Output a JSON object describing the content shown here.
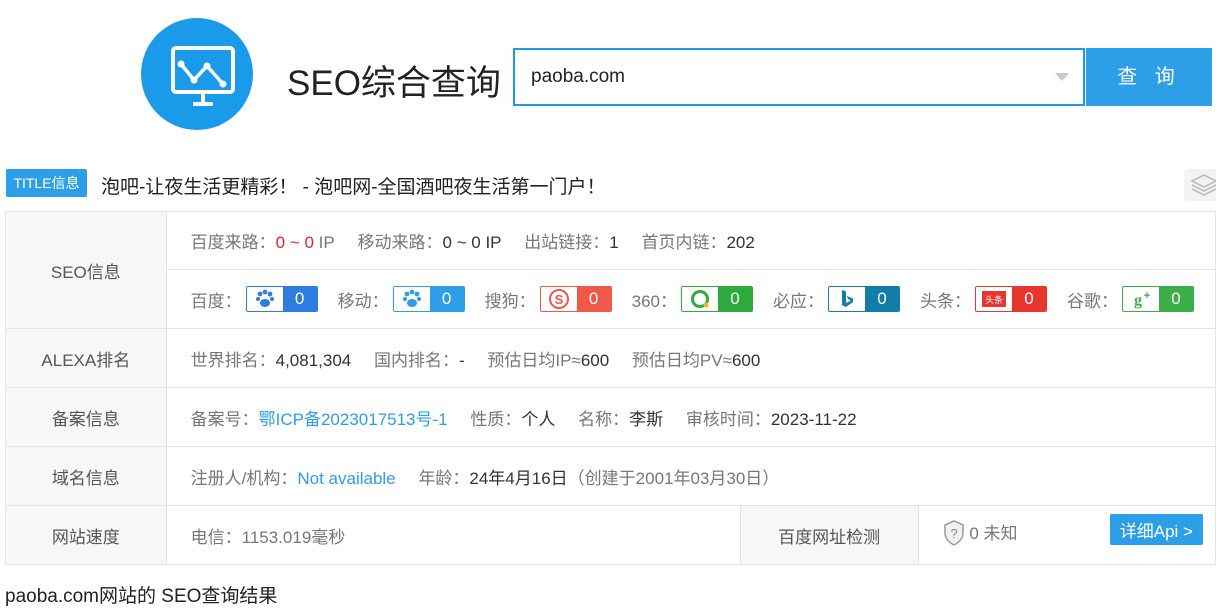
{
  "header": {
    "brand": "SEO综合查询",
    "search_value": "paoba.com",
    "search_button": "查 询"
  },
  "title_bar": {
    "badge": "TITLE信息",
    "text": "泡吧-让夜生活更精彩！ - 泡吧网-全国酒吧夜生活第一门户！"
  },
  "seo": {
    "label": "SEO信息",
    "baidu_traffic_label": "百度来路：",
    "baidu_traffic_value": "0 ~ 0",
    "baidu_traffic_unit": "IP",
    "mobile_traffic_label": "移动来路：",
    "mobile_traffic_value": "0 ~ 0 IP",
    "outlinks_label": "出站链接：",
    "outlinks_value": "1",
    "inlinks_label": "首页内链：",
    "inlinks_value": "202",
    "weights": [
      {
        "label": "百度：",
        "value": "0",
        "icon": "baidu-paw-icon",
        "color": "#2d7de0"
      },
      {
        "label": "移动：",
        "value": "0",
        "icon": "mobile-paw-icon",
        "color": "#2d9fe8"
      },
      {
        "label": "搜狗：",
        "value": "0",
        "icon": "sogou-icon",
        "color": "#f0584a"
      },
      {
        "label": "360：",
        "value": "0",
        "icon": "360-icon",
        "color": "#2fab3d"
      },
      {
        "label": "必应：",
        "value": "0",
        "icon": "bing-icon",
        "color": "#127ea8"
      },
      {
        "label": "头条：",
        "value": "0",
        "icon": "toutiao-icon",
        "color": "#e8362f"
      },
      {
        "label": "谷歌：",
        "value": "0",
        "icon": "google-plus-icon",
        "color": "#3cae4a"
      }
    ]
  },
  "alexa": {
    "label": "ALEXA排名",
    "world_label": "世界排名：",
    "world_value": "4,081,304",
    "domestic_label": "国内排名：",
    "domestic_value": "-",
    "ip_label": "预估日均IP≈",
    "ip_value": "600",
    "pv_label": "预估日均PV≈",
    "pv_value": "600"
  },
  "icp": {
    "label": "备案信息",
    "no_label": "备案号：",
    "no_value": "鄂ICP备2023017513号-1",
    "type_label": "性质：",
    "type_value": "个人",
    "name_label": "名称：",
    "name_value": "李斯",
    "date_label": "审核时间：",
    "date_value": "2023-11-22"
  },
  "domain": {
    "label": "域名信息",
    "registrant_label": "注册人/机构：",
    "registrant_value": "Not available",
    "age_label": "年龄：",
    "age_value": "24年4月16日",
    "created": "（创建于2001年03月30日）"
  },
  "speed": {
    "label": "网站速度",
    "telecom_label": "电信：",
    "telecom_value": "1153.019毫秒",
    "check_label": "百度网址检测",
    "check_value": "0 未知",
    "api_button": "详细Api >"
  },
  "footer": "paoba.com网站的 SEO查询结果"
}
